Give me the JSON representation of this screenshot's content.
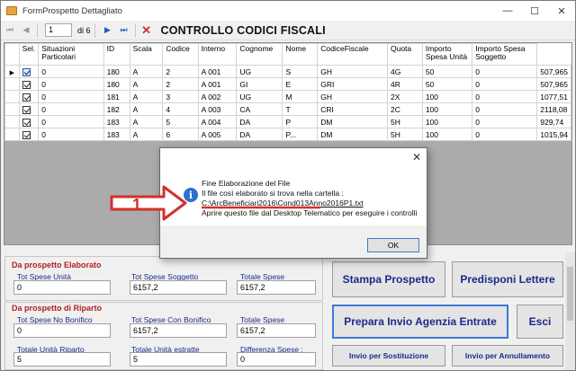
{
  "window": {
    "title": "FormProspetto Dettagliato",
    "min": "—",
    "max": "☐",
    "close": "✕"
  },
  "toolbar": {
    "first": "⏮",
    "prev": "◀",
    "position": "1",
    "of": "di 6",
    "next": "▶",
    "last": "⏭",
    "delete": "✕",
    "form_title": "CONTROLLO CODICI FISCALI"
  },
  "grid": {
    "headers": [
      "Sel.",
      "Situazioni Particolari",
      "ID",
      "Scala",
      "Codice",
      "Interno",
      "Cognome",
      "Nome",
      "CodiceFiscale",
      "Quota",
      "Importo Spesa Unità",
      "Importo Spesa Soggetto"
    ],
    "rows": [
      [
        "0",
        "180",
        "A",
        "2",
        "A 001",
        "UG",
        "S",
        "GH",
        "4G",
        "50",
        "0",
        "507,965"
      ],
      [
        "0",
        "180",
        "A",
        "2",
        "A 001",
        "GI",
        "E",
        "GRI",
        "4R",
        "50",
        "0",
        "507,965"
      ],
      [
        "0",
        "181",
        "A",
        "3",
        "A 002",
        "UG",
        "M",
        "GH",
        "2X",
        "100",
        "0",
        "1077,51"
      ],
      [
        "0",
        "182",
        "A",
        "4",
        "A 003",
        "CA",
        "T",
        "CRI",
        "2C",
        "100",
        "0",
        "2118,08"
      ],
      [
        "0",
        "183",
        "A",
        "5",
        "A 004",
        "DA",
        "P",
        "DM",
        "5H",
        "100",
        "0",
        "929,74"
      ],
      [
        "0",
        "183",
        "A",
        "6",
        "A 005",
        "DA",
        "P...",
        "DM",
        "5H",
        "100",
        "0",
        "1015,94"
      ]
    ]
  },
  "sections": {
    "elaborato": {
      "title": "Da prospetto Elaborato",
      "tot_unita_label": "Tot Spese Unità",
      "tot_unita": "0",
      "tot_soggetto_label": "Tot Spese Soggetto",
      "tot_soggetto": "6157,2",
      "totale_label": "Totale Spese",
      "totale": "6157,2"
    },
    "riparto": {
      "title": "Da prospetto di Riparto",
      "no_bonifico_label": "Tot Spese No Bonifico",
      "no_bonifico": "0",
      "con_bonifico_label": "Tot Spese Con Bonifico",
      "con_bonifico": "6157,2",
      "totale_label": "Totale Spese",
      "totale": "6157,2",
      "unita_riparto_label": "Totale Unità Riparto",
      "unita_riparto": "5",
      "unita_estratte_label": "Totale Unità estratte",
      "unita_estratte": "5",
      "differenza_label": "Differenza Spese :",
      "differenza": "0"
    }
  },
  "buttons": {
    "stampa": "Stampa Prospetto",
    "predisponi": "Predisponi Lettere",
    "prepara": "Prepara Invio Agenzia Entrate",
    "esci": "Esci",
    "sostituzione": "Invio per Sostituzione",
    "annullamento": "Invio per Annullamento"
  },
  "dialog": {
    "close": "✕",
    "icon": "i",
    "lines": [
      "Fine Elaborazione del File",
      "Il file così elaborato si trova nella cartella :",
      "C:\\ArcBeneficiari2016\\Cond013Anno2016P1.txt",
      "Aprire questo file dal Desktop Telematico per eseguire i controlli"
    ],
    "ok": "OK"
  },
  "annotation": {
    "number": "1",
    "color": "#d0312d"
  }
}
